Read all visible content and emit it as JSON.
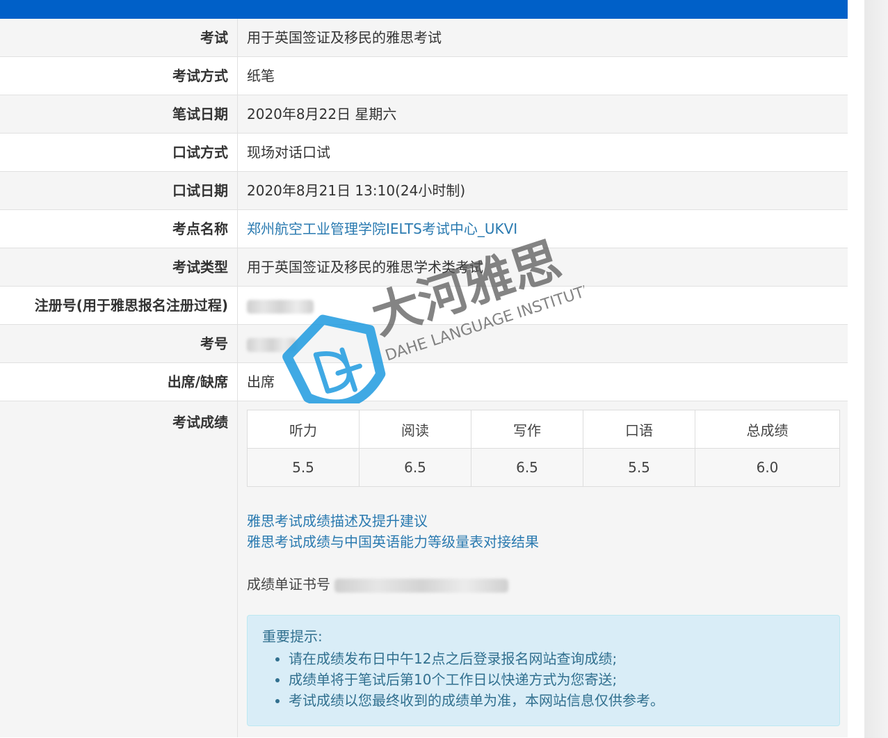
{
  "rows": [
    {
      "label": "考试",
      "value": "用于英国签证及移民的雅思考试"
    },
    {
      "label": "考试方式",
      "value": "纸笔"
    },
    {
      "label": "笔试日期",
      "value": "2020年8月22日 星期六"
    },
    {
      "label": "口试方式",
      "value": "现场对话口试"
    },
    {
      "label": "口试日期",
      "value": "2020年8月21日 13:10(24小时制)"
    },
    {
      "label": "考点名称",
      "value": "郑州航空工业管理学院IELTS考试中心_UKVI"
    },
    {
      "label": "考试类型",
      "value": "用于英国签证及移民的雅思学术类考试"
    },
    {
      "label": "注册号(用于雅思报名注册过程)",
      "value": ""
    },
    {
      "label": "考号",
      "value": ""
    },
    {
      "label": "出席/缺席",
      "value": "出席"
    }
  ],
  "scores": {
    "label": "考试成绩",
    "headers": [
      "听力",
      "阅读",
      "写作",
      "口语",
      "总成绩"
    ],
    "values": [
      "5.5",
      "6.5",
      "6.5",
      "5.5",
      "6.0"
    ]
  },
  "links": [
    "雅思考试成绩描述及提升建议",
    "雅思考试成绩与中国英语能力等级量表对接结果"
  ],
  "certificate_label": "成绩单证书号",
  "notice": {
    "title": "重要提示:",
    "items": [
      "请在成绩发布日中午12点之后登录报名网站查询成绩;",
      "成绩单将于笔试后第10个工作日以快递方式为您寄送;",
      "考试成绩以您最终收到的成绩单为准，本网站信息仅供参考。"
    ]
  },
  "watermark": {
    "name_cn": "大河雅思",
    "name_en": "DAHE LANGUAGE INSTITUTE"
  },
  "colors": {
    "topbar": "#0060c8",
    "link": "#2a7ab0",
    "notice_bg": "#d9edf7",
    "notice_text": "#31708f"
  }
}
